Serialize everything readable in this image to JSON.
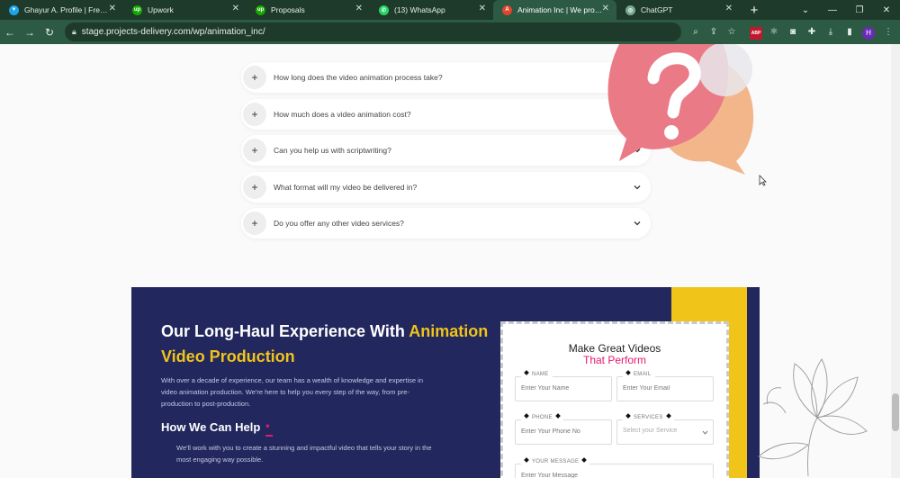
{
  "browser": {
    "tabs": [
      {
        "title": "Ghayur A. Profile | Freelancer",
        "fav_color": "#1ea4e9",
        "fav_glyph": "▼",
        "active": false
      },
      {
        "title": "Upwork",
        "fav_color": "#14a800",
        "fav_glyph": "up",
        "active": false
      },
      {
        "title": "Proposals",
        "fav_color": "#14a800",
        "fav_glyph": "up",
        "active": false
      },
      {
        "title": "(13) WhatsApp",
        "fav_color": "#25d366",
        "fav_glyph": "✆",
        "active": false
      },
      {
        "title": "Animation Inc | We provide",
        "fav_color": "#e0452b",
        "fav_glyph": "A",
        "active": true
      },
      {
        "title": "ChatGPT",
        "fav_color": "#7aa894",
        "fav_glyph": "◎",
        "active": false
      }
    ],
    "address": "stage.projects-delivery.com/wp/animation_inc/",
    "extensions": {
      "abp": "ABP",
      "avatar": "H"
    }
  },
  "faq": {
    "items": [
      {
        "question": "How long does the video animation process take?"
      },
      {
        "question": "How much does a video animation cost?"
      },
      {
        "question": "Can you help us with scriptwriting?"
      },
      {
        "question": "What format will my video be delivered in?"
      },
      {
        "question": "Do you offer any other video services?"
      }
    ]
  },
  "experience": {
    "title_plain": "Our Long-Haul Experience With ",
    "title_highlight": "Animation Video Production",
    "body": "With over a decade of experience, our team has a wealth of knowledge and expertise in video animation production. We're here to help you every step of the way, from pre-production to post-production.",
    "help_title": "How We Can Help",
    "help_body": "We'll work with you to create a stunning and impactful video that tells your story in the most engaging way possible."
  },
  "form": {
    "title_line1": "Make Great Videos",
    "title_line2": "That Perform",
    "name_label": "NAME",
    "name_placeholder": "Enter Your Name",
    "email_label": "EMAIL",
    "email_placeholder": "Enter Your Email",
    "phone_label": "PHONE",
    "phone_placeholder": "Enter Your Phone No",
    "services_label": "SERVICES",
    "services_value": "Select your Service",
    "message_label": "YOUR MESSAGE",
    "message_placeholder": "Enter Your Message"
  },
  "colors": {
    "browser_dark": "#1e3a2a",
    "browser_light": "#2d5a42",
    "section_navy": "#22275e",
    "accent_yellow": "#f0c419",
    "accent_pink": "#e6196b"
  }
}
